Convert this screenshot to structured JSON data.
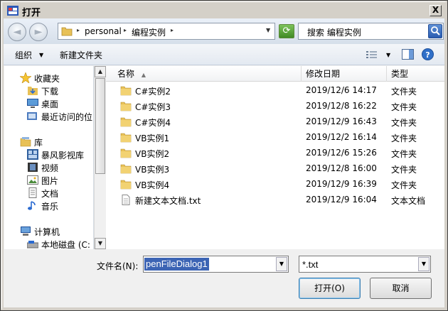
{
  "window": {
    "title": "打开",
    "close_label": "X"
  },
  "navbar": {
    "back_label": "◄",
    "forward_label": "►",
    "breadcrumbs": [
      {
        "label": "personal"
      },
      {
        "label": "编程实例"
      }
    ],
    "search_text": "搜索 编程实例"
  },
  "toolbar": {
    "organize": "组织",
    "new_folder": "新建文件夹"
  },
  "sidebar": {
    "items": [
      {
        "label": "收藏夹",
        "icon": "star-icon"
      },
      {
        "label": "下载",
        "icon": "download-folder-icon"
      },
      {
        "label": "桌面",
        "icon": "desktop-icon"
      },
      {
        "label": "最近访问的位",
        "icon": "recent-places-icon"
      },
      {
        "label": "库",
        "icon": "library-icon"
      },
      {
        "label": "暴风影视库",
        "icon": "video-library-icon"
      },
      {
        "label": "视频",
        "icon": "video-icon"
      },
      {
        "label": "图片",
        "icon": "pictures-icon"
      },
      {
        "label": "文档",
        "icon": "documents-icon"
      },
      {
        "label": "音乐",
        "icon": "music-icon"
      },
      {
        "label": "计算机",
        "icon": "computer-icon"
      },
      {
        "label": "本地磁盘 (C:",
        "icon": "drive-icon"
      }
    ]
  },
  "columns": {
    "name": "名称",
    "modified": "修改日期",
    "type": "类型"
  },
  "files": [
    {
      "name": "C#实例2",
      "modified": "2019/12/6 14:17",
      "type": "文件夹",
      "icon": "folder-icon"
    },
    {
      "name": "C#实例3",
      "modified": "2019/12/8 16:22",
      "type": "文件夹",
      "icon": "folder-icon"
    },
    {
      "name": "C#实例4",
      "modified": "2019/12/9 16:43",
      "type": "文件夹",
      "icon": "folder-icon"
    },
    {
      "name": "VB实例1",
      "modified": "2019/12/2 16:14",
      "type": "文件夹",
      "icon": "folder-icon"
    },
    {
      "name": "VB实例2",
      "modified": "2019/12/6 15:26",
      "type": "文件夹",
      "icon": "folder-icon"
    },
    {
      "name": "VB实例3",
      "modified": "2019/12/8 16:00",
      "type": "文件夹",
      "icon": "folder-icon"
    },
    {
      "name": "VB实例4",
      "modified": "2019/12/9 16:39",
      "type": "文件夹",
      "icon": "folder-icon"
    },
    {
      "name": "新建文本文档.txt",
      "modified": "2019/12/9 16:04",
      "type": "文本文档",
      "icon": "text-file-icon"
    }
  ],
  "bottom": {
    "filename_label": "文件名(N):",
    "filename_value": "penFileDialog1",
    "filter_value": "*.txt",
    "open_label": "打开(O)",
    "cancel_label": "取消"
  },
  "colors": {
    "selection": "#3c64b4",
    "folder": "#e8c157"
  }
}
